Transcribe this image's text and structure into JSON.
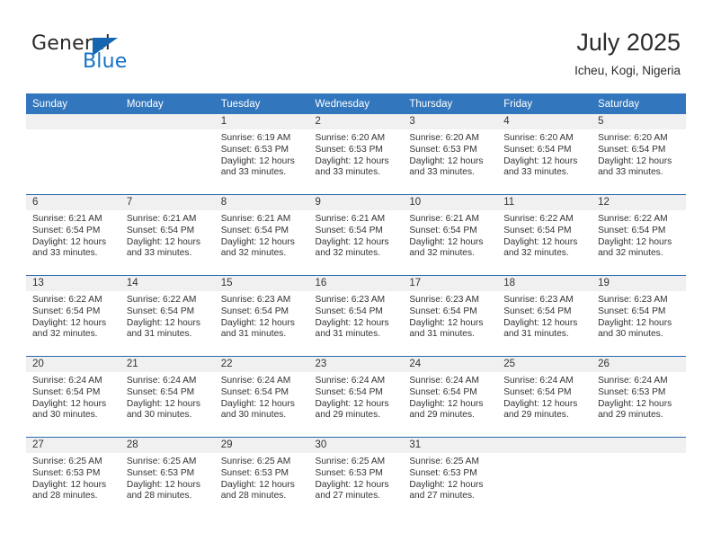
{
  "brand": {
    "name_top": "General",
    "name_bottom": "Blue",
    "accent_color": "#1572c6",
    "triangle_color": "#1565b0"
  },
  "header": {
    "title": "July 2025",
    "subtitle": "Icheu, Kogi, Nigeria"
  },
  "calendar": {
    "header_bg": "#3276bd",
    "header_text_color": "#ffffff",
    "row_divider_color": "#2a69ad",
    "daynum_bg": "#f0f0f0",
    "weekdays": [
      "Sunday",
      "Monday",
      "Tuesday",
      "Wednesday",
      "Thursday",
      "Friday",
      "Saturday"
    ],
    "weeks": [
      [
        {
          "day": "",
          "lines": []
        },
        {
          "day": "",
          "lines": []
        },
        {
          "day": "1",
          "lines": [
            "Sunrise: 6:19 AM",
            "Sunset: 6:53 PM",
            "Daylight: 12 hours and 33 minutes."
          ]
        },
        {
          "day": "2",
          "lines": [
            "Sunrise: 6:20 AM",
            "Sunset: 6:53 PM",
            "Daylight: 12 hours and 33 minutes."
          ]
        },
        {
          "day": "3",
          "lines": [
            "Sunrise: 6:20 AM",
            "Sunset: 6:53 PM",
            "Daylight: 12 hours and 33 minutes."
          ]
        },
        {
          "day": "4",
          "lines": [
            "Sunrise: 6:20 AM",
            "Sunset: 6:54 PM",
            "Daylight: 12 hours and 33 minutes."
          ]
        },
        {
          "day": "5",
          "lines": [
            "Sunrise: 6:20 AM",
            "Sunset: 6:54 PM",
            "Daylight: 12 hours and 33 minutes."
          ]
        }
      ],
      [
        {
          "day": "6",
          "lines": [
            "Sunrise: 6:21 AM",
            "Sunset: 6:54 PM",
            "Daylight: 12 hours and 33 minutes."
          ]
        },
        {
          "day": "7",
          "lines": [
            "Sunrise: 6:21 AM",
            "Sunset: 6:54 PM",
            "Daylight: 12 hours and 33 minutes."
          ]
        },
        {
          "day": "8",
          "lines": [
            "Sunrise: 6:21 AM",
            "Sunset: 6:54 PM",
            "Daylight: 12 hours and 32 minutes."
          ]
        },
        {
          "day": "9",
          "lines": [
            "Sunrise: 6:21 AM",
            "Sunset: 6:54 PM",
            "Daylight: 12 hours and 32 minutes."
          ]
        },
        {
          "day": "10",
          "lines": [
            "Sunrise: 6:21 AM",
            "Sunset: 6:54 PM",
            "Daylight: 12 hours and 32 minutes."
          ]
        },
        {
          "day": "11",
          "lines": [
            "Sunrise: 6:22 AM",
            "Sunset: 6:54 PM",
            "Daylight: 12 hours and 32 minutes."
          ]
        },
        {
          "day": "12",
          "lines": [
            "Sunrise: 6:22 AM",
            "Sunset: 6:54 PM",
            "Daylight: 12 hours and 32 minutes."
          ]
        }
      ],
      [
        {
          "day": "13",
          "lines": [
            "Sunrise: 6:22 AM",
            "Sunset: 6:54 PM",
            "Daylight: 12 hours and 32 minutes."
          ]
        },
        {
          "day": "14",
          "lines": [
            "Sunrise: 6:22 AM",
            "Sunset: 6:54 PM",
            "Daylight: 12 hours and 31 minutes."
          ]
        },
        {
          "day": "15",
          "lines": [
            "Sunrise: 6:23 AM",
            "Sunset: 6:54 PM",
            "Daylight: 12 hours and 31 minutes."
          ]
        },
        {
          "day": "16",
          "lines": [
            "Sunrise: 6:23 AM",
            "Sunset: 6:54 PM",
            "Daylight: 12 hours and 31 minutes."
          ]
        },
        {
          "day": "17",
          "lines": [
            "Sunrise: 6:23 AM",
            "Sunset: 6:54 PM",
            "Daylight: 12 hours and 31 minutes."
          ]
        },
        {
          "day": "18",
          "lines": [
            "Sunrise: 6:23 AM",
            "Sunset: 6:54 PM",
            "Daylight: 12 hours and 31 minutes."
          ]
        },
        {
          "day": "19",
          "lines": [
            "Sunrise: 6:23 AM",
            "Sunset: 6:54 PM",
            "Daylight: 12 hours and 30 minutes."
          ]
        }
      ],
      [
        {
          "day": "20",
          "lines": [
            "Sunrise: 6:24 AM",
            "Sunset: 6:54 PM",
            "Daylight: 12 hours and 30 minutes."
          ]
        },
        {
          "day": "21",
          "lines": [
            "Sunrise: 6:24 AM",
            "Sunset: 6:54 PM",
            "Daylight: 12 hours and 30 minutes."
          ]
        },
        {
          "day": "22",
          "lines": [
            "Sunrise: 6:24 AM",
            "Sunset: 6:54 PM",
            "Daylight: 12 hours and 30 minutes."
          ]
        },
        {
          "day": "23",
          "lines": [
            "Sunrise: 6:24 AM",
            "Sunset: 6:54 PM",
            "Daylight: 12 hours and 29 minutes."
          ]
        },
        {
          "day": "24",
          "lines": [
            "Sunrise: 6:24 AM",
            "Sunset: 6:54 PM",
            "Daylight: 12 hours and 29 minutes."
          ]
        },
        {
          "day": "25",
          "lines": [
            "Sunrise: 6:24 AM",
            "Sunset: 6:54 PM",
            "Daylight: 12 hours and 29 minutes."
          ]
        },
        {
          "day": "26",
          "lines": [
            "Sunrise: 6:24 AM",
            "Sunset: 6:53 PM",
            "Daylight: 12 hours and 29 minutes."
          ]
        }
      ],
      [
        {
          "day": "27",
          "lines": [
            "Sunrise: 6:25 AM",
            "Sunset: 6:53 PM",
            "Daylight: 12 hours and 28 minutes."
          ]
        },
        {
          "day": "28",
          "lines": [
            "Sunrise: 6:25 AM",
            "Sunset: 6:53 PM",
            "Daylight: 12 hours and 28 minutes."
          ]
        },
        {
          "day": "29",
          "lines": [
            "Sunrise: 6:25 AM",
            "Sunset: 6:53 PM",
            "Daylight: 12 hours and 28 minutes."
          ]
        },
        {
          "day": "30",
          "lines": [
            "Sunrise: 6:25 AM",
            "Sunset: 6:53 PM",
            "Daylight: 12 hours and 27 minutes."
          ]
        },
        {
          "day": "31",
          "lines": [
            "Sunrise: 6:25 AM",
            "Sunset: 6:53 PM",
            "Daylight: 12 hours and 27 minutes."
          ]
        },
        {
          "day": "",
          "lines": []
        },
        {
          "day": "",
          "lines": []
        }
      ]
    ]
  }
}
